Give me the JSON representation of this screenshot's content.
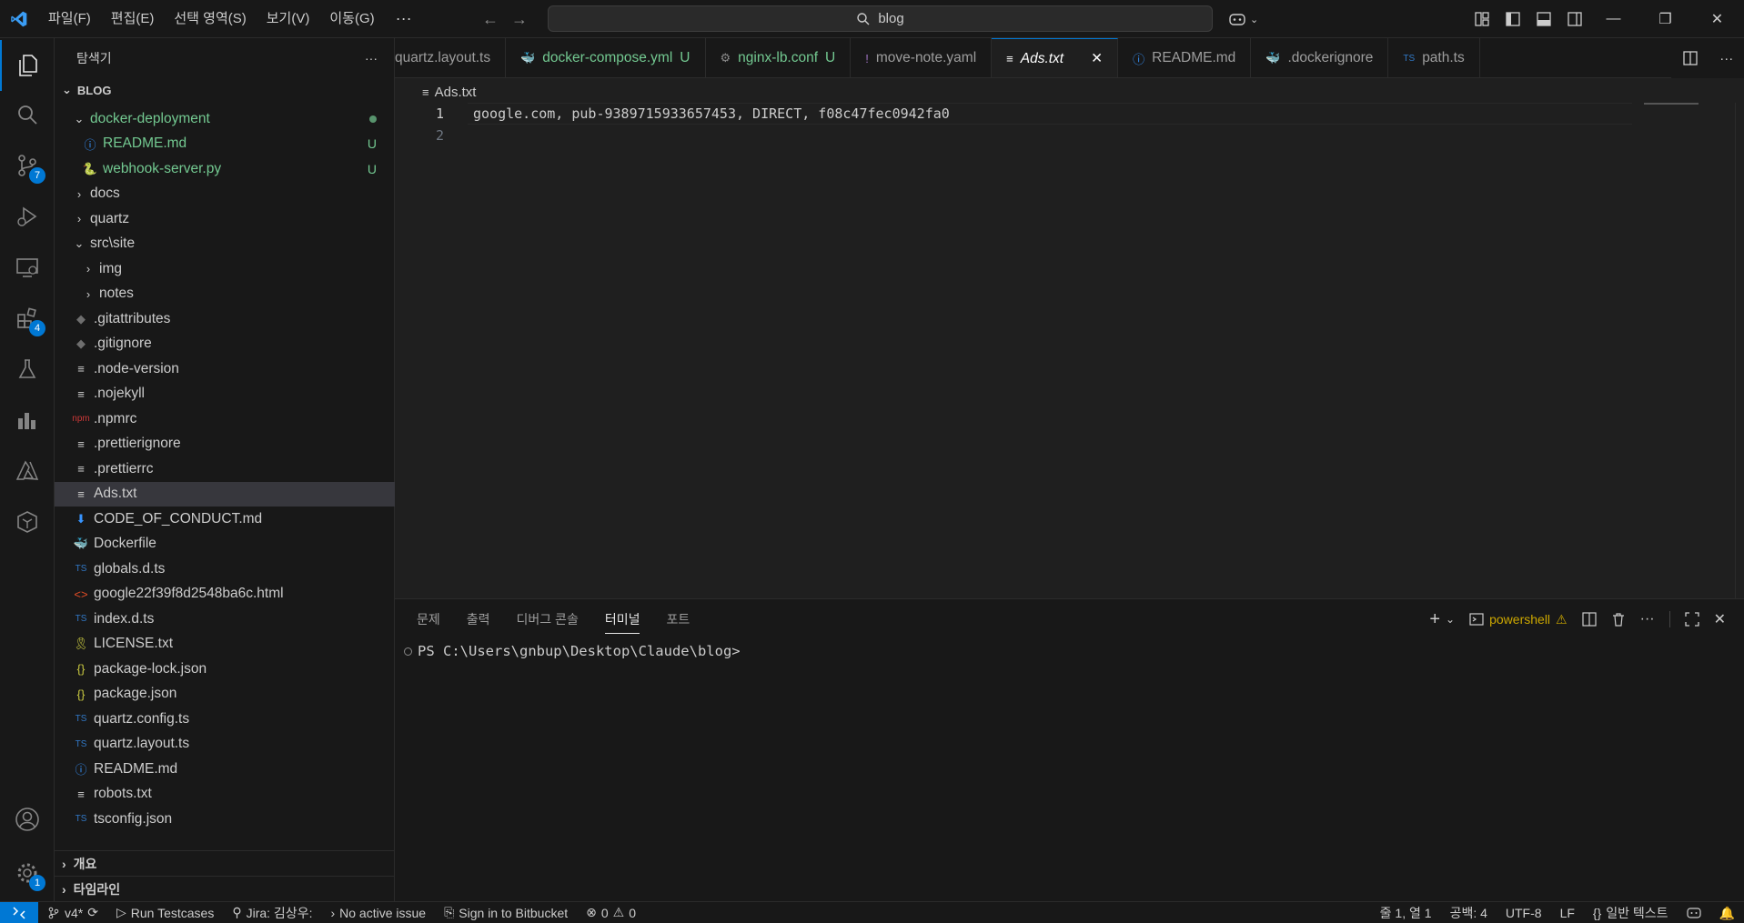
{
  "titlebar": {
    "menu": [
      "파일(F)",
      "편집(E)",
      "선택 영역(S)",
      "보기(V)",
      "이동(G)"
    ],
    "more": "···",
    "search": "blog"
  },
  "activity_badges": {
    "scm": "7",
    "extensions": "4",
    "settings": "1"
  },
  "sidebar": {
    "title": "탐색기",
    "more": "···",
    "root": "BLOG",
    "tree": [
      {
        "label": "docker-deployment",
        "depth": 1,
        "kind": "folder-open",
        "status": "dot",
        "color": "green"
      },
      {
        "label": "README.md",
        "depth": 2,
        "kind": "info",
        "status": "U",
        "color": "green"
      },
      {
        "label": "webhook-server.py",
        "depth": 2,
        "kind": "python",
        "status": "U",
        "color": "green"
      },
      {
        "label": "docs",
        "depth": 1,
        "kind": "folder",
        "status": "",
        "color": ""
      },
      {
        "label": "quartz",
        "depth": 1,
        "kind": "folder",
        "status": "",
        "color": ""
      },
      {
        "label": "src\\site",
        "depth": 1,
        "kind": "folder-open",
        "status": "",
        "color": ""
      },
      {
        "label": "img",
        "depth": 2,
        "kind": "folder",
        "status": "",
        "color": ""
      },
      {
        "label": "notes",
        "depth": 2,
        "kind": "folder",
        "status": "",
        "color": ""
      },
      {
        "label": ".gitattributes",
        "depth": 1,
        "kind": "git",
        "status": "",
        "color": ""
      },
      {
        "label": ".gitignore",
        "depth": 1,
        "kind": "git",
        "status": "",
        "color": ""
      },
      {
        "label": ".node-version",
        "depth": 1,
        "kind": "text",
        "status": "",
        "color": ""
      },
      {
        "label": ".nojekyll",
        "depth": 1,
        "kind": "text",
        "status": "",
        "color": ""
      },
      {
        "label": ".npmrc",
        "depth": 1,
        "kind": "npm",
        "status": "",
        "color": ""
      },
      {
        "label": ".prettierignore",
        "depth": 1,
        "kind": "text",
        "status": "",
        "color": ""
      },
      {
        "label": ".prettierrc",
        "depth": 1,
        "kind": "text",
        "status": "",
        "color": ""
      },
      {
        "label": "Ads.txt",
        "depth": 1,
        "kind": "text",
        "status": "",
        "color": "",
        "selected": true
      },
      {
        "label": "CODE_OF_CONDUCT.md",
        "depth": 1,
        "kind": "md-down",
        "status": "",
        "color": ""
      },
      {
        "label": "Dockerfile",
        "depth": 1,
        "kind": "docker",
        "status": "",
        "color": ""
      },
      {
        "label": "globals.d.ts",
        "depth": 1,
        "kind": "ts",
        "status": "",
        "color": ""
      },
      {
        "label": "google22f39f8d2548ba6c.html",
        "depth": 1,
        "kind": "html",
        "status": "",
        "color": ""
      },
      {
        "label": "index.d.ts",
        "depth": 1,
        "kind": "ts",
        "status": "",
        "color": ""
      },
      {
        "label": "LICENSE.txt",
        "depth": 1,
        "kind": "license",
        "status": "",
        "color": ""
      },
      {
        "label": "package-lock.json",
        "depth": 1,
        "kind": "json",
        "status": "",
        "color": ""
      },
      {
        "label": "package.json",
        "depth": 1,
        "kind": "json",
        "status": "",
        "color": ""
      },
      {
        "label": "quartz.config.ts",
        "depth": 1,
        "kind": "ts",
        "status": "",
        "color": ""
      },
      {
        "label": "quartz.layout.ts",
        "depth": 1,
        "kind": "ts",
        "status": "",
        "color": ""
      },
      {
        "label": "README.md",
        "depth": 1,
        "kind": "info",
        "status": "",
        "color": ""
      },
      {
        "label": "robots.txt",
        "depth": 1,
        "kind": "text",
        "status": "",
        "color": ""
      },
      {
        "label": "tsconfig.json",
        "depth": 1,
        "kind": "tsconfig",
        "status": "",
        "color": ""
      }
    ],
    "outline": "개요",
    "timeline": "타임라인"
  },
  "tabs": [
    {
      "label": "quartz.layout.ts",
      "icon": "",
      "status": ""
    },
    {
      "label": "docker-compose.yml",
      "icon": "docker",
      "status": "U",
      "green": true
    },
    {
      "label": "nginx-lb.conf",
      "icon": "gear",
      "status": "U",
      "green": true
    },
    {
      "label": "move-note.yaml",
      "icon": "excl",
      "status": ""
    },
    {
      "label": "Ads.txt",
      "icon": "text",
      "status": "",
      "active": true
    },
    {
      "label": "README.md",
      "icon": "info",
      "status": ""
    },
    {
      "label": ".dockerignore",
      "icon": "docker-gray",
      "status": ""
    },
    {
      "label": "path.ts",
      "icon": "ts",
      "status": ""
    }
  ],
  "editor": {
    "breadcrumb": "Ads.txt",
    "lines": [
      {
        "n": "1",
        "text": "google.com, pub-9389715933657453, DIRECT, f08c47fec0942fa0"
      },
      {
        "n": "2",
        "text": ""
      }
    ]
  },
  "panel": {
    "tabs": [
      "문제",
      "출력",
      "디버그 콘솔",
      "터미널",
      "포트"
    ],
    "active_tab": "터미널",
    "shell": "powershell",
    "prompt": "PS C:\\Users\\gnbup\\Desktop\\Claude\\blog>"
  },
  "statusbar": {
    "branch": "v4*",
    "run": "Run Testcases",
    "jira": "Jira: 김상우:",
    "issue": "No active issue",
    "bitbucket": "Sign in to Bitbucket",
    "errors": "0",
    "warnings": "0",
    "position": "줄 1, 열 1",
    "spaces": "공백: 4",
    "encoding": "UTF-8",
    "eol": "LF",
    "language": "일반 텍스트"
  },
  "colors": {
    "accent": "#0078d4",
    "untracked": "#73c991",
    "warning": "#cca700"
  }
}
